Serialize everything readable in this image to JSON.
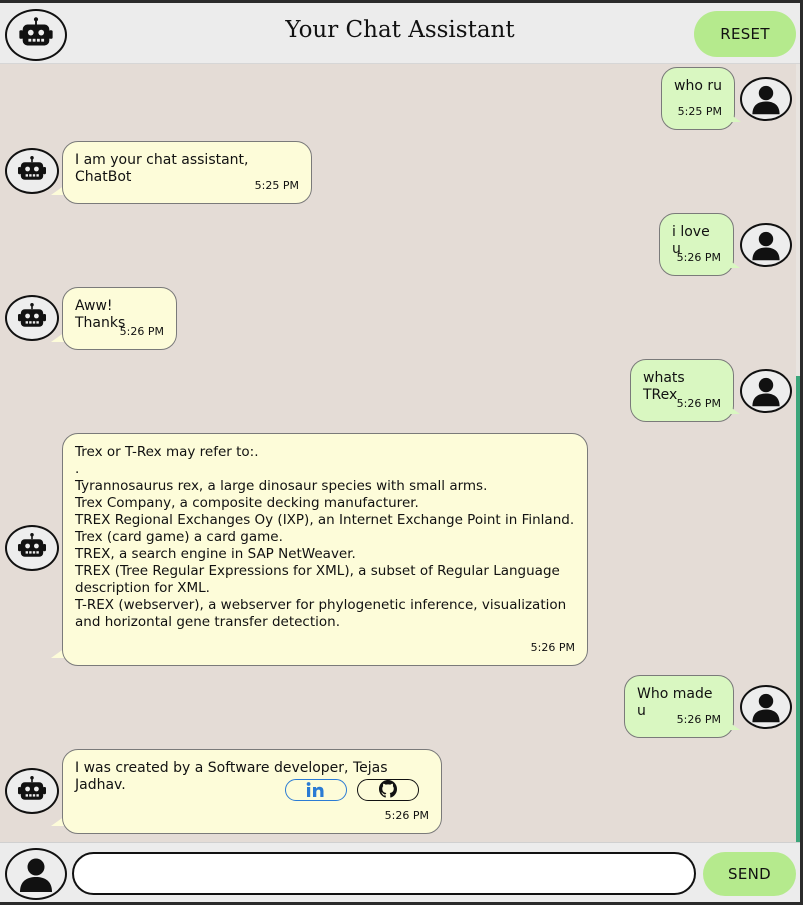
{
  "header": {
    "title": "Your Chat Assistant",
    "reset_label": "RESET",
    "bot_icon": "robot-icon"
  },
  "messages": [
    {
      "sender": "user",
      "text": "who ru",
      "time": "5:25 PM"
    },
    {
      "sender": "bot",
      "text": "I am your chat assistant, ChatBot",
      "time": "5:25 PM"
    },
    {
      "sender": "user",
      "text": "i love u",
      "time": "5:26 PM"
    },
    {
      "sender": "bot",
      "text": "Aww! Thanks",
      "time": "5:26 PM"
    },
    {
      "sender": "user",
      "text": "whats TRex",
      "time": "5:26 PM"
    },
    {
      "sender": "bot",
      "text": "Trex or T-Rex may refer to:.\n.\nTyrannosaurus rex, a large dinosaur species with small arms.\nTrex Company, a composite decking manufacturer.\nTREX Regional Exchanges Oy (IXP), an Internet Exchange Point in Finland.\nTrex (card game) a card game.\nTREX, a search engine in SAP NetWeaver.\nTREX (Tree Regular Expressions for XML), a subset of Regular Language\ndescription for XML.\nT-REX (webserver), a webserver for phylogenetic inference, visualization\nand horizontal gene transfer detection.",
      "time": "5:26 PM"
    },
    {
      "sender": "user",
      "text": "Who made u",
      "time": "5:26 PM"
    },
    {
      "sender": "bot",
      "text": "I was created by a Software developer, Tejas Jadhav.",
      "time": "5:26 PM",
      "links": [
        "linkedin-icon",
        "github-icon"
      ]
    }
  ],
  "footer": {
    "input_value": "",
    "send_label": "SEND",
    "user_icon": "user-icon"
  },
  "colors": {
    "chat_background": "#e4dcd6",
    "user_bubble": "#d9f7c1",
    "bot_bubble": "#fdfcd9",
    "button_green": "#b5ea8d",
    "scrollbar_thumb": "#3aa57a",
    "linkedin_blue": "#2b7bd4"
  }
}
